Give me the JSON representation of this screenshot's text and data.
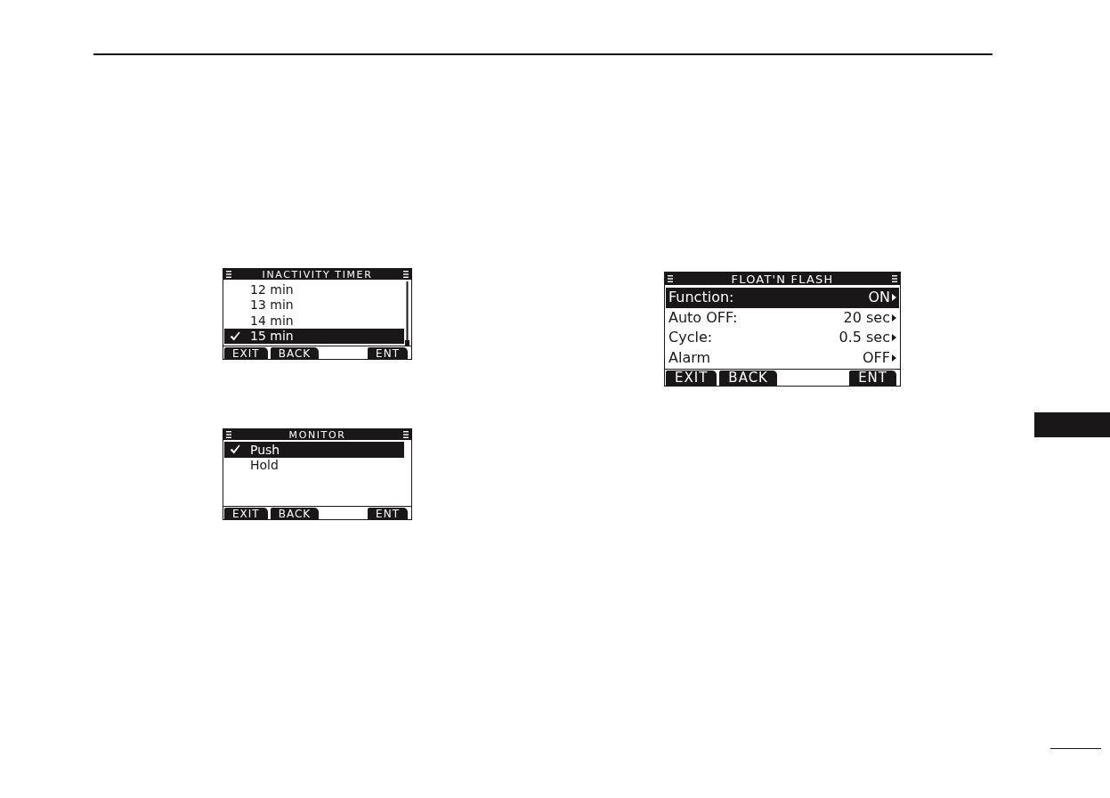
{
  "screens": [
    {
      "kind": "list",
      "title": "INACTIVITY TIMER",
      "items": [
        {
          "label": "12 min",
          "selected": false,
          "checked": false
        },
        {
          "label": "13 min",
          "selected": false,
          "checked": false
        },
        {
          "label": "14 min",
          "selected": false,
          "checked": false
        },
        {
          "label": "15 min",
          "selected": true,
          "checked": true
        }
      ],
      "softkeys": [
        "EXIT",
        "BACK",
        "ENT"
      ]
    },
    {
      "kind": "list",
      "title": "MONITOR",
      "items": [
        {
          "label": "Push",
          "selected": true,
          "checked": true
        },
        {
          "label": "Hold",
          "selected": false,
          "checked": false
        }
      ],
      "softkeys": [
        "EXIT",
        "BACK",
        "ENT"
      ]
    },
    {
      "kind": "settings",
      "title": "FLOAT'N FLASH",
      "items": [
        {
          "label": "Function:",
          "value": "ON",
          "selected": true
        },
        {
          "label": "Auto OFF:",
          "value": "20 sec",
          "selected": false
        },
        {
          "label": "Cycle:",
          "value": "0.5 sec",
          "selected": false
        },
        {
          "label": "Alarm",
          "value": "OFF",
          "selected": false
        }
      ],
      "softkeys": [
        "EXIT",
        "BACK",
        "ENT"
      ]
    }
  ]
}
